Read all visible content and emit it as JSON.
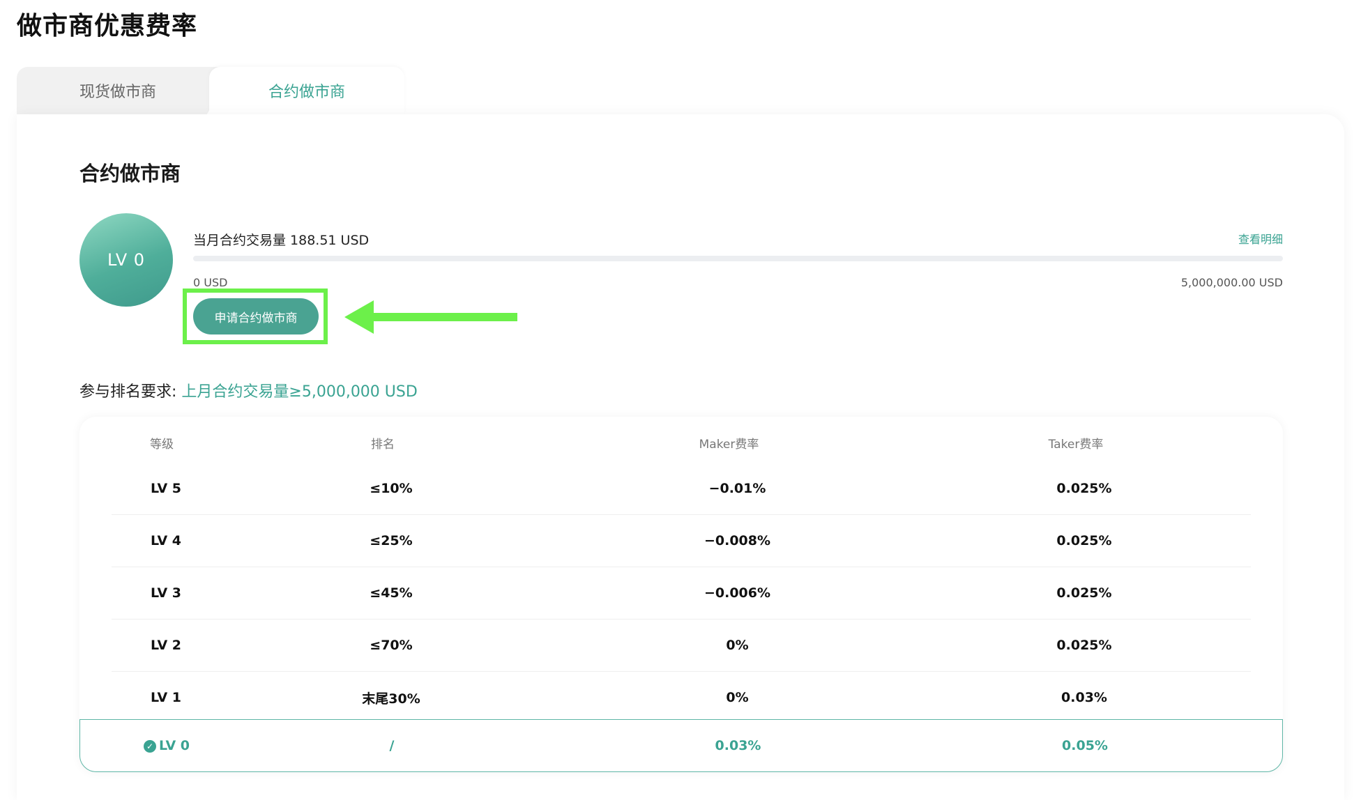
{
  "page": {
    "title": "做市商优惠费率"
  },
  "tabs": [
    {
      "label": "现货做市商",
      "active": false
    },
    {
      "label": "合约做市商",
      "active": true
    }
  ],
  "card": {
    "title": "合约做市商",
    "level_badge": "LV 0",
    "volume_text": "当月合约交易量 188.51 USD",
    "detail_link": "查看明细",
    "progress": {
      "value": 188.51,
      "min_label": "0 USD",
      "max_label": "5,000,000.00 USD",
      "min": 0,
      "max": 5000000
    },
    "apply_button": "申请合约做市商",
    "requirement_label": "参与排名要求: ",
    "requirement_value": "上月合约交易量≥5,000,000 USD"
  },
  "table": {
    "columns": [
      "等级",
      "排名",
      "Maker费率",
      "Taker费率"
    ],
    "rows": [
      {
        "level": "LV 5",
        "rank": "≤10%",
        "maker": "−0.01%",
        "taker": "0.025%"
      },
      {
        "level": "LV 4",
        "rank": "≤25%",
        "maker": "−0.008%",
        "taker": "0.025%"
      },
      {
        "level": "LV 3",
        "rank": "≤45%",
        "maker": "−0.006%",
        "taker": "0.025%"
      },
      {
        "level": "LV 2",
        "rank": "≤70%",
        "maker": "0%",
        "taker": "0.025%"
      },
      {
        "level": "LV 1",
        "rank": "末尾30%",
        "maker": "0%",
        "taker": "0.03%"
      }
    ],
    "current_row": {
      "level": "LV 0",
      "rank": "/",
      "maker": "0.03%",
      "taker": "0.05%",
      "check_icon": "✓"
    }
  },
  "colors": {
    "accent": "#3aa392",
    "highlight": "#6cf04a"
  }
}
